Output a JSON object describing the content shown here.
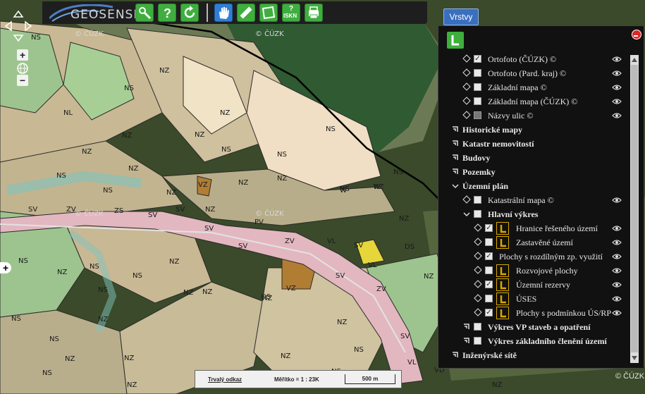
{
  "app": {
    "name": "GEOSENSE"
  },
  "toolbar": {
    "buttons": [
      {
        "name": "search-button",
        "icon": "search-key-icon",
        "color": "#3fae3f"
      },
      {
        "name": "help-button",
        "icon": "question-icon",
        "color": "#3fae3f"
      },
      {
        "name": "refresh-button",
        "icon": "refresh-icon",
        "color": "#3fae3f"
      },
      {
        "name": "pan-button",
        "icon": "hand-icon",
        "color": "#2f7fd6"
      },
      {
        "name": "measure-button",
        "icon": "ruler-icon",
        "color": "#3fae3f"
      },
      {
        "name": "area-button",
        "icon": "polygon-icon",
        "color": "#3fae3f"
      },
      {
        "name": "iskn-button",
        "icon": "iskn-icon",
        "label": "ISKN",
        "color": "#3fae3f"
      },
      {
        "name": "print-button",
        "icon": "print-icon",
        "color": "#3fae3f"
      }
    ],
    "iskn_label": "ISKN",
    "iskn_q": "?"
  },
  "panel": {
    "tab_label": "Vrstvy",
    "rows": [
      {
        "label": "Ortofoto (ČÚZK) ©",
        "checked": true,
        "eye": true
      },
      {
        "label": "Ortofoto (Pard. kraj) ©",
        "checked": false,
        "eye": true
      },
      {
        "label": "Základní mapa ©",
        "checked": false,
        "eye": true
      },
      {
        "label": "Základní mapa (ČÚZK) ©",
        "checked": false,
        "eye": true
      },
      {
        "label": "Názvy ulic ©",
        "checked": false,
        "disabled": true,
        "eye": true
      },
      {
        "label": "Historické mapy",
        "group": true
      },
      {
        "label": "Katastr nemovitostí",
        "group": true
      },
      {
        "label": "Budovy",
        "group": true
      },
      {
        "label": "Pozemky",
        "group": true
      },
      {
        "label": "Územní plán",
        "group": true,
        "open": true
      },
      {
        "label": "Katastrální mapa ©",
        "checked": false,
        "eye": true
      },
      {
        "label": "Hlavní výkres",
        "group": true,
        "open": true
      },
      {
        "label": "Hranice řešeného území",
        "checked": true,
        "legend": true,
        "eye": true
      },
      {
        "label": "Zastavěné území",
        "checked": false,
        "legend": true,
        "eye": true
      },
      {
        "label": "Plochy s rozdílným zp. využití",
        "checked": true,
        "eye": true
      },
      {
        "label": "Rozvojové plochy",
        "checked": false,
        "legend": true,
        "eye": true
      },
      {
        "label": "Územní rezervy",
        "checked": true,
        "legend": true,
        "eye": true
      },
      {
        "label": "ÚSES",
        "checked": false,
        "legend": true,
        "eye": true
      },
      {
        "label": "Plochy s podmínkou ÚS/RP",
        "checked": true,
        "legend": true,
        "eye": true
      },
      {
        "label": "Výkres VP staveb a opatření",
        "group": true,
        "checkbox": true
      },
      {
        "label": "Výkres základního členění území",
        "group": true,
        "checkbox": true
      },
      {
        "label": "Inženýrské sítě",
        "group": true
      }
    ]
  },
  "scalebar": {
    "link": "Trvalý odkaz",
    "scale": "Měřítko = 1 : 23K",
    "bar": "500 m"
  },
  "copyright": "© ČÚZK",
  "map": {
    "labels": [
      "NS",
      "NZ",
      "NS",
      "NL",
      "NZ",
      "NS",
      "NZ",
      "NZ",
      "NS",
      "NS",
      "NZ",
      "NZ",
      "NS",
      "NS",
      "NZ",
      "NZ",
      "NZ",
      "VZ",
      "NS",
      "NS",
      "NZ",
      "W",
      "W",
      "NZ",
      "SV",
      "ZV",
      "ZS",
      "SV",
      "SV",
      "NZ",
      "PV",
      "SV",
      "SV",
      "ZV",
      "VL",
      "SV",
      "DS",
      "NS",
      "NZ",
      "NZ",
      "NS",
      "NS",
      "NZ",
      "NS",
      "NZ",
      "VZ",
      "OS",
      "ZV",
      "SV",
      "VL",
      "NZ",
      "NZ",
      "NZ",
      "NS",
      "NZ",
      "NS",
      "NZ",
      "NZ",
      "NS",
      "NZ",
      "NZ",
      "SV",
      "VL",
      "VD",
      "NS",
      "NZ",
      "NS",
      "NZ"
    ],
    "watermark": "© ČÚZK",
    "accent_green": "#4fa84f",
    "nz_color": "#c9b894",
    "ns_color": "#9dc48e",
    "sv_color": "#e3b7c0"
  }
}
